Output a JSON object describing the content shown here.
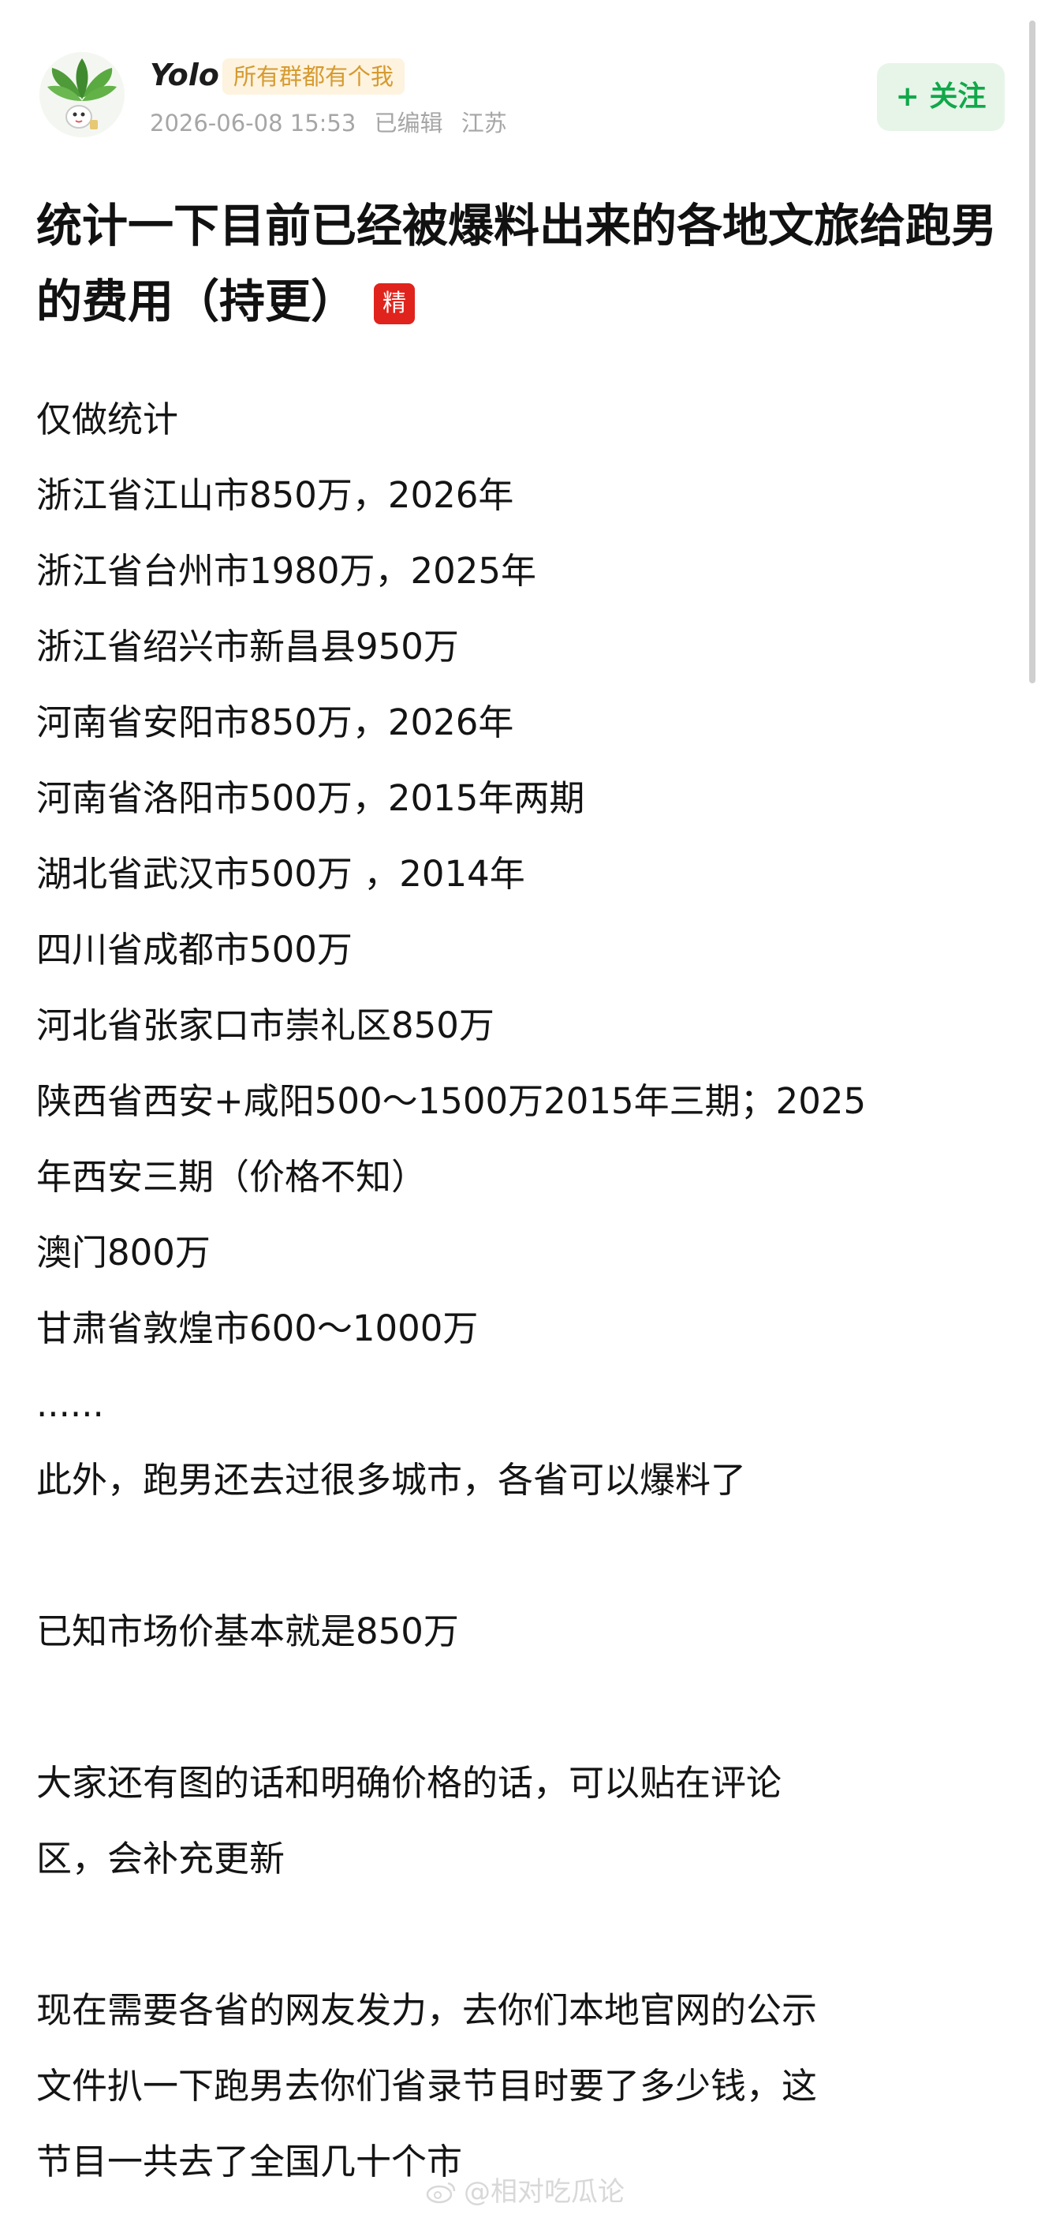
{
  "post": {
    "user": {
      "name": "Yolo",
      "badge": "所有群都有个我",
      "avatar_icon": "plant-avatar"
    },
    "meta": {
      "datetime": "2026-06-08 15:53",
      "edited": "已编辑",
      "location": "江苏"
    },
    "follow_label": "+ 关注",
    "title": "统计一下目前已经被爆料出来的各地文旅给跑男的费用（持更）",
    "featured_badge": "精",
    "lines": [
      "仅做统计",
      "浙江省江山市850万，2026年",
      "浙江省台州市1980万，2025年",
      "浙江省绍兴市新昌县950万",
      "河南省安阳市850万，2026年",
      "河南省洛阳市500万，2015年两期",
      "湖北省武汉市500万 ，2014年",
      "四川省成都市500万",
      "河北省张家口市崇礼区850万",
      "陕西省西安+咸阳500～1500万2015年三期；2025",
      "年西安三期（价格不知）",
      "澳门800万",
      "甘肃省敦煌市600～1000万",
      "......",
      "此外，跑男还去过很多城市，各省可以爆料了",
      "",
      "已知市场价基本就是850万",
      "",
      "大家还有图的话和明确价格的话，可以贴在评论",
      "区，会补充更新",
      "",
      "现在需要各省的网友发力，去你们本地官网的公示",
      "文件扒一下跑男去你们省录节目时要了多少钱，这",
      "节目一共去了全国几十个市"
    ]
  },
  "watermark": "@相对吃瓜论",
  "colors": {
    "follow_bg": "#e6f5e8",
    "follow_text": "#11a84a",
    "badge_bg": "#fdf3df",
    "badge_text": "#d69a2f",
    "featured_bg": "#e0231c"
  }
}
